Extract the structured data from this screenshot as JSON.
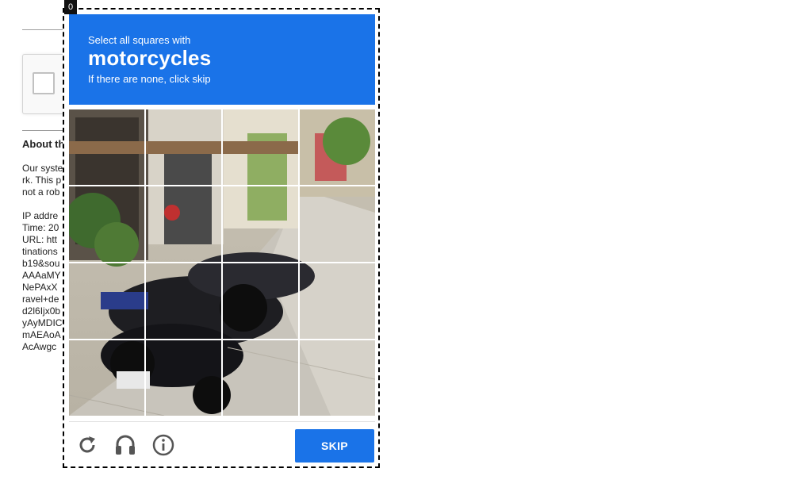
{
  "challenge": {
    "badge": "0",
    "instruction_prefix": "Select all squares with",
    "target_object": "motorcycles",
    "instruction_suffix": "If there are none, click skip",
    "skip_label": "SKIP",
    "icons": [
      "reload-icon",
      "audio-icon",
      "info-icon"
    ]
  },
  "background_page": {
    "about_title": "About th",
    "lines": [
      "Our syste",
      "rk. This p",
      "not a rob",
      "",
      "IP addre",
      "Time: 20",
      "URL: htt",
      "tinations",
      "b19&sou",
      "AAAaMY",
      "NePAxX",
      "ravel+de",
      "d2l6Ijx0b",
      "yAyMDIC",
      "mAEAoA",
      "AcAwgc"
    ]
  },
  "colors": {
    "accent": "#1a73e8",
    "white": "#ffffff"
  }
}
